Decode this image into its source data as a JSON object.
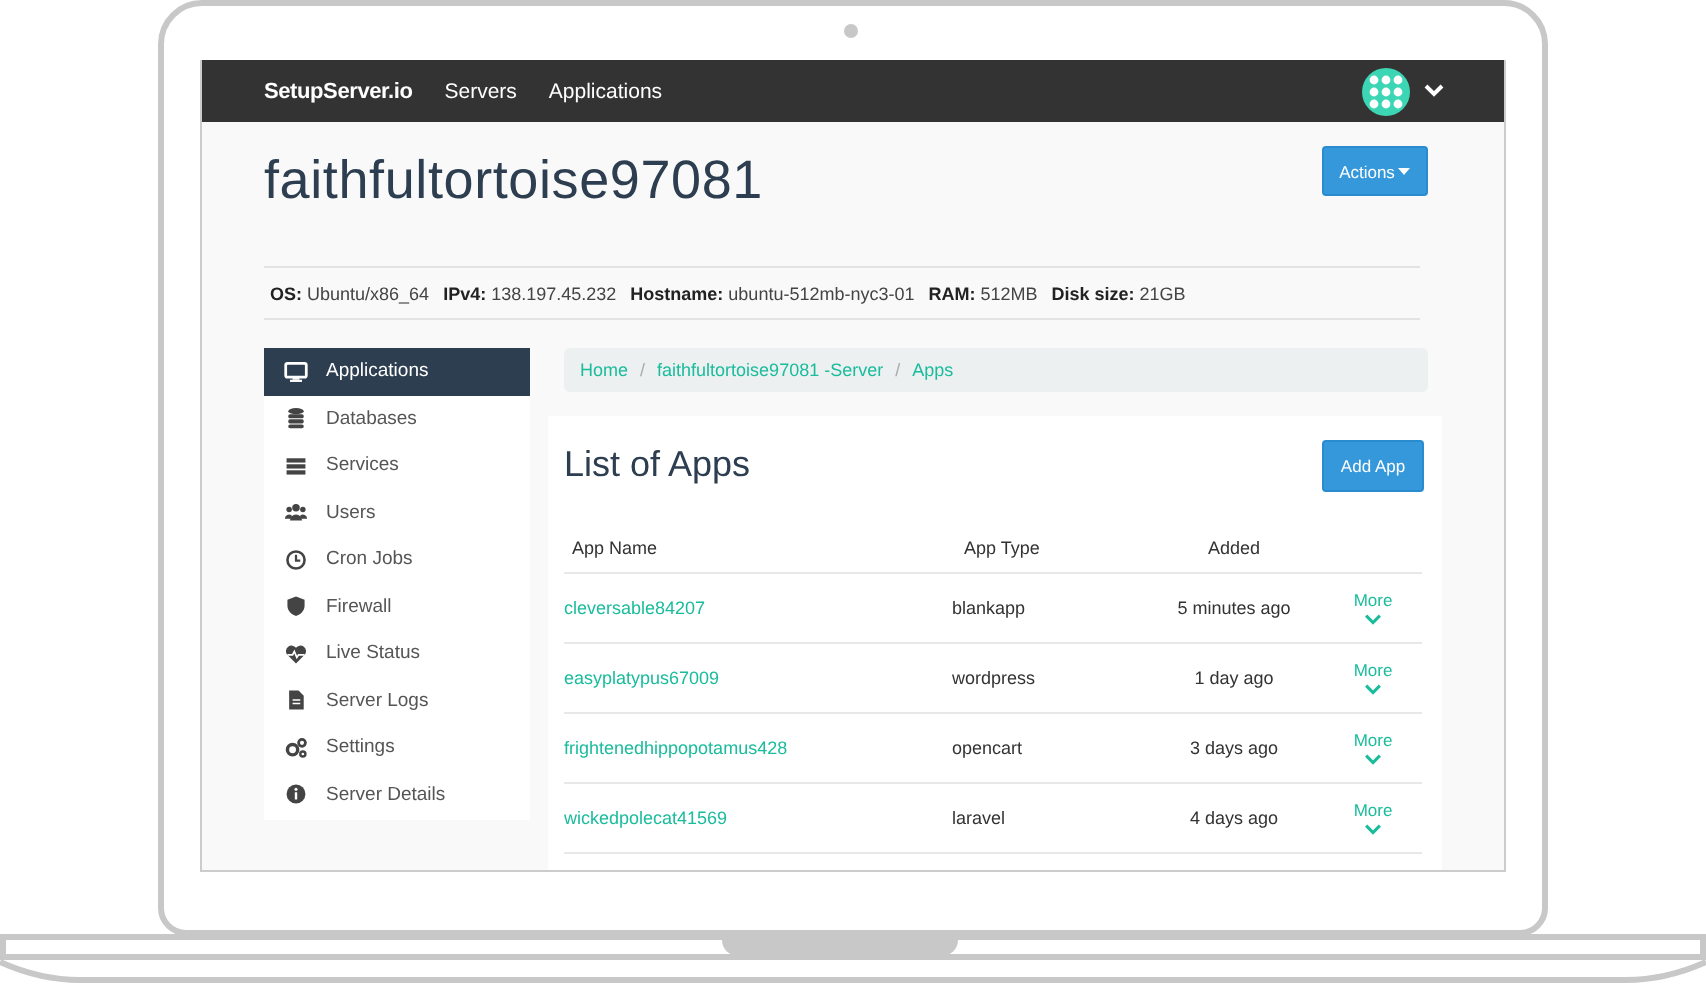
{
  "navbar": {
    "brand": "SetupServer.io",
    "links": [
      "Servers",
      "Applications"
    ]
  },
  "server": {
    "title": "faithfultortoise97081",
    "actions_button": "Actions",
    "info": [
      "**OS:** Ubuntu/x86_64",
      "**IPv4:** 138.197.45.232",
      "**Hostname:** ubuntu-512mb-nyc3-01",
      "**RAM:** 512MB",
      "**Disk size:** 21GB"
    ]
  },
  "sidebar": {
    "items": [
      {
        "label": "Applications",
        "selected": true
      },
      {
        "label": "Databases",
        "selected": false
      },
      {
        "label": "Services",
        "selected": false
      },
      {
        "label": "Users",
        "selected": false
      },
      {
        "label": "Cron Jobs",
        "selected": false
      },
      {
        "label": "Firewall",
        "selected": false
      },
      {
        "label": "Live Status",
        "selected": false
      },
      {
        "label": "Server Logs",
        "selected": false
      },
      {
        "label": "Settings",
        "selected": false
      },
      {
        "label": "Server Details",
        "selected": false
      }
    ]
  },
  "breadcrumb": {
    "separator": "/",
    "items": [
      "Home",
      "faithfultortoise97081 -Server",
      "Apps"
    ]
  },
  "apps": {
    "title": "List of Apps",
    "add_button": "Add App",
    "columns": [
      "App Name",
      "App Type",
      "Added"
    ],
    "rows": [
      {
        "name": "cleversable84207",
        "type": "blankapp",
        "added": "5 minutes ago",
        "more": "More"
      },
      {
        "name": "easyplatypus67009",
        "type": "wordpress",
        "added": "1 day ago",
        "more": "More"
      },
      {
        "name": "frightenedhippopotamus428",
        "type": "opencart",
        "added": "3 days ago",
        "more": "More"
      },
      {
        "name": "wickedpolecat41569",
        "type": "laravel",
        "added": "4 days ago",
        "more": "More"
      }
    ]
  }
}
